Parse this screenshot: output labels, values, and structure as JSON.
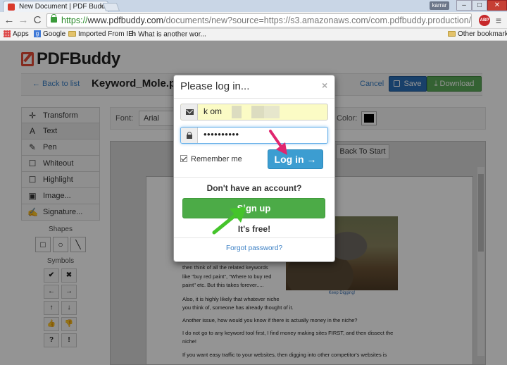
{
  "browser": {
    "tab_title": "New Document | PDF Buddy",
    "tab_close": "×",
    "user_badge": "karrar",
    "win_min": "–",
    "win_max": "□",
    "win_close": "✕",
    "nav_back": "←",
    "nav_forward": "→",
    "nav_reload": "C",
    "url_scheme": "https://",
    "url_host": "www.pdfbuddy.com",
    "url_path": "/documents/new?source=https://s3.amazonaws.com/com.pdfbuddy.production/tmp%...",
    "abp_label": "ABP",
    "menu_icon": "≡",
    "bookmarks": [
      "Apps",
      "Google",
      "Imported From IE",
      "What is another wor..."
    ],
    "other_bookmarks": "Other bookmarks"
  },
  "app": {
    "logo_pdf": "PDF",
    "logo_buddy": "Buddy",
    "back_to_list": "← Back to list",
    "file_name": "Keyword_Mole.pdf",
    "cancel": "Cancel",
    "save": "Save",
    "download": "Download"
  },
  "tools": [
    {
      "icon": "✛",
      "label": "Transform"
    },
    {
      "icon": "A",
      "label": "Text"
    },
    {
      "icon": "✎",
      "label": "Pen"
    },
    {
      "icon": "☐",
      "label": "Whiteout"
    },
    {
      "icon": "☐",
      "label": "Highlight"
    },
    {
      "icon": "▣",
      "label": "Image..."
    },
    {
      "icon": "✍",
      "label": "Signature..."
    }
  ],
  "shapes_label": "Shapes",
  "shapes": [
    "□",
    "○",
    "╲"
  ],
  "symbols_label": "Symbols",
  "symbols": [
    "✔",
    "✖",
    "←",
    "→",
    "↑",
    "↓",
    "👍",
    "👎",
    "?",
    "!"
  ],
  "fontbar": {
    "font_label": "Font:",
    "font_value": "Arial",
    "color_label": "Color:",
    "color_value": "#000000"
  },
  "canvas": {
    "back_to_start": "Back To Start",
    "caption": "Keep Digging!",
    "paragraphs": [
      "then think of all the related keywords",
      "like \"buy red paint\", \"Where to buy red",
      "paint\" etc. But this takes forever.....",
      "Also, it is highly likely that whatever niche",
      "you think of, someone has already thought of it.",
      "Another issue, how would you know if there is actually money in the niche?",
      "I do not go to any keyword tool first, I find money making sites FIRST, and then dissect the",
      "niche!",
      "If you want easy traffic to your websites, then digging into other competitor's websites is"
    ]
  },
  "modal": {
    "title": "Please log in...",
    "close": "×",
    "email_value": "k                      om",
    "password_value": "••••••••••",
    "remember_me": "Remember me",
    "login_button": "Log in →",
    "no_account": "Don't have an account?",
    "signup_button": "Sign up",
    "free_text": "It's free!",
    "forgot_password": "Forgot password?"
  },
  "annotation_colors": {
    "pink_arrow": "#e0266f",
    "green_arrow": "#45c42b"
  }
}
